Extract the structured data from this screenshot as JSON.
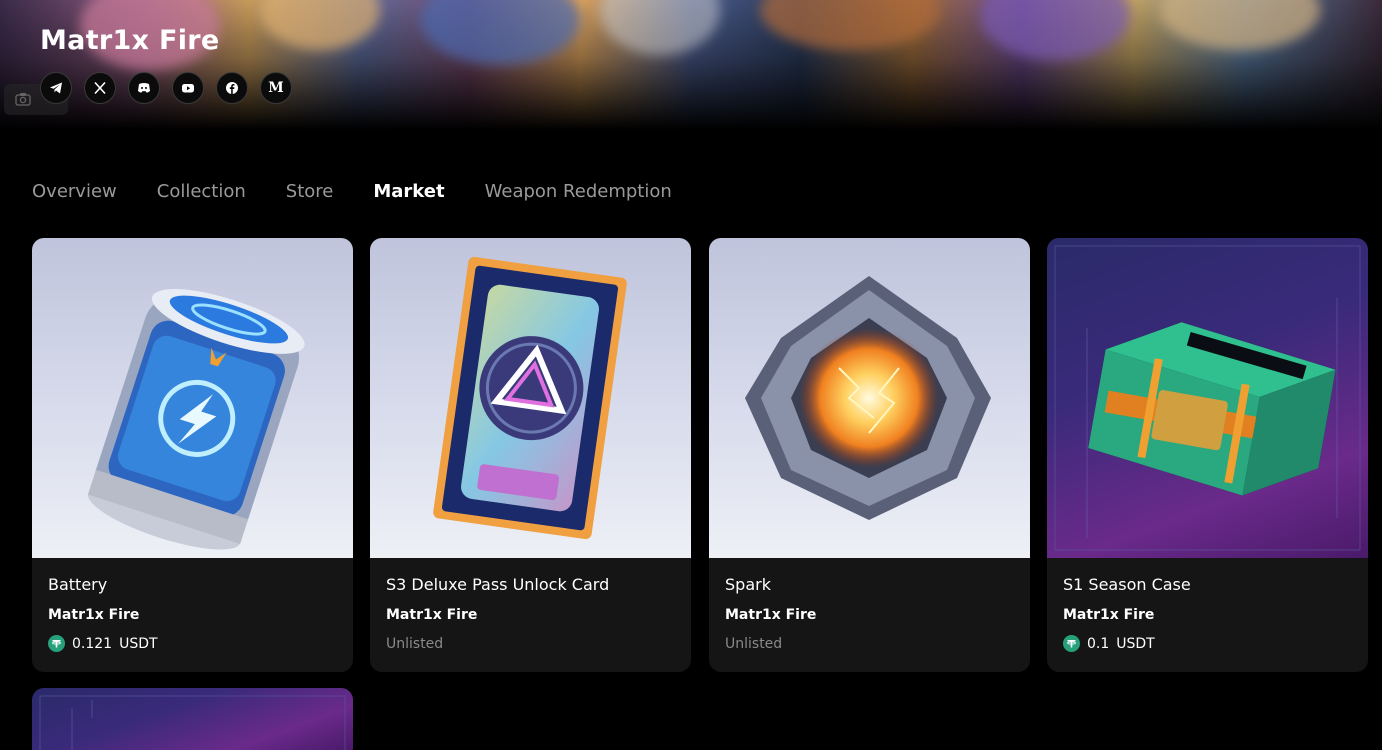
{
  "header": {
    "title": "Matr1x Fire",
    "socials": [
      {
        "icon": "telegram-icon"
      },
      {
        "icon": "x-icon"
      },
      {
        "icon": "discord-icon"
      },
      {
        "icon": "youtube-icon"
      },
      {
        "icon": "facebook-icon"
      },
      {
        "icon": "medium-icon",
        "glyph": "M"
      }
    ]
  },
  "tabs": [
    {
      "label": "Overview",
      "active": false
    },
    {
      "label": "Collection",
      "active": false
    },
    {
      "label": "Store",
      "active": false
    },
    {
      "label": "Market",
      "active": true
    },
    {
      "label": "Weapon Redemption",
      "active": false
    }
  ],
  "cards": [
    {
      "name": "Battery",
      "collection": "Matr1x Fire",
      "price": "0.121",
      "currency": "USDT",
      "status": "",
      "image": "battery-image"
    },
    {
      "name": "S3 Deluxe Pass Unlock Card",
      "collection": "Matr1x Fire",
      "price": "",
      "currency": "",
      "status": "Unlisted",
      "image": "pass-card-image"
    },
    {
      "name": "Spark",
      "collection": "Matr1x Fire",
      "price": "",
      "currency": "",
      "status": "Unlisted",
      "image": "spark-image"
    },
    {
      "name": "S1 Season Case",
      "collection": "Matr1x Fire",
      "price": "0.1",
      "currency": "USDT",
      "status": "",
      "image": "season-case-image"
    }
  ],
  "colors": {
    "background": "#000000",
    "card": "#151515",
    "tether": "#26a17b",
    "muted": "#9a9a9a"
  }
}
